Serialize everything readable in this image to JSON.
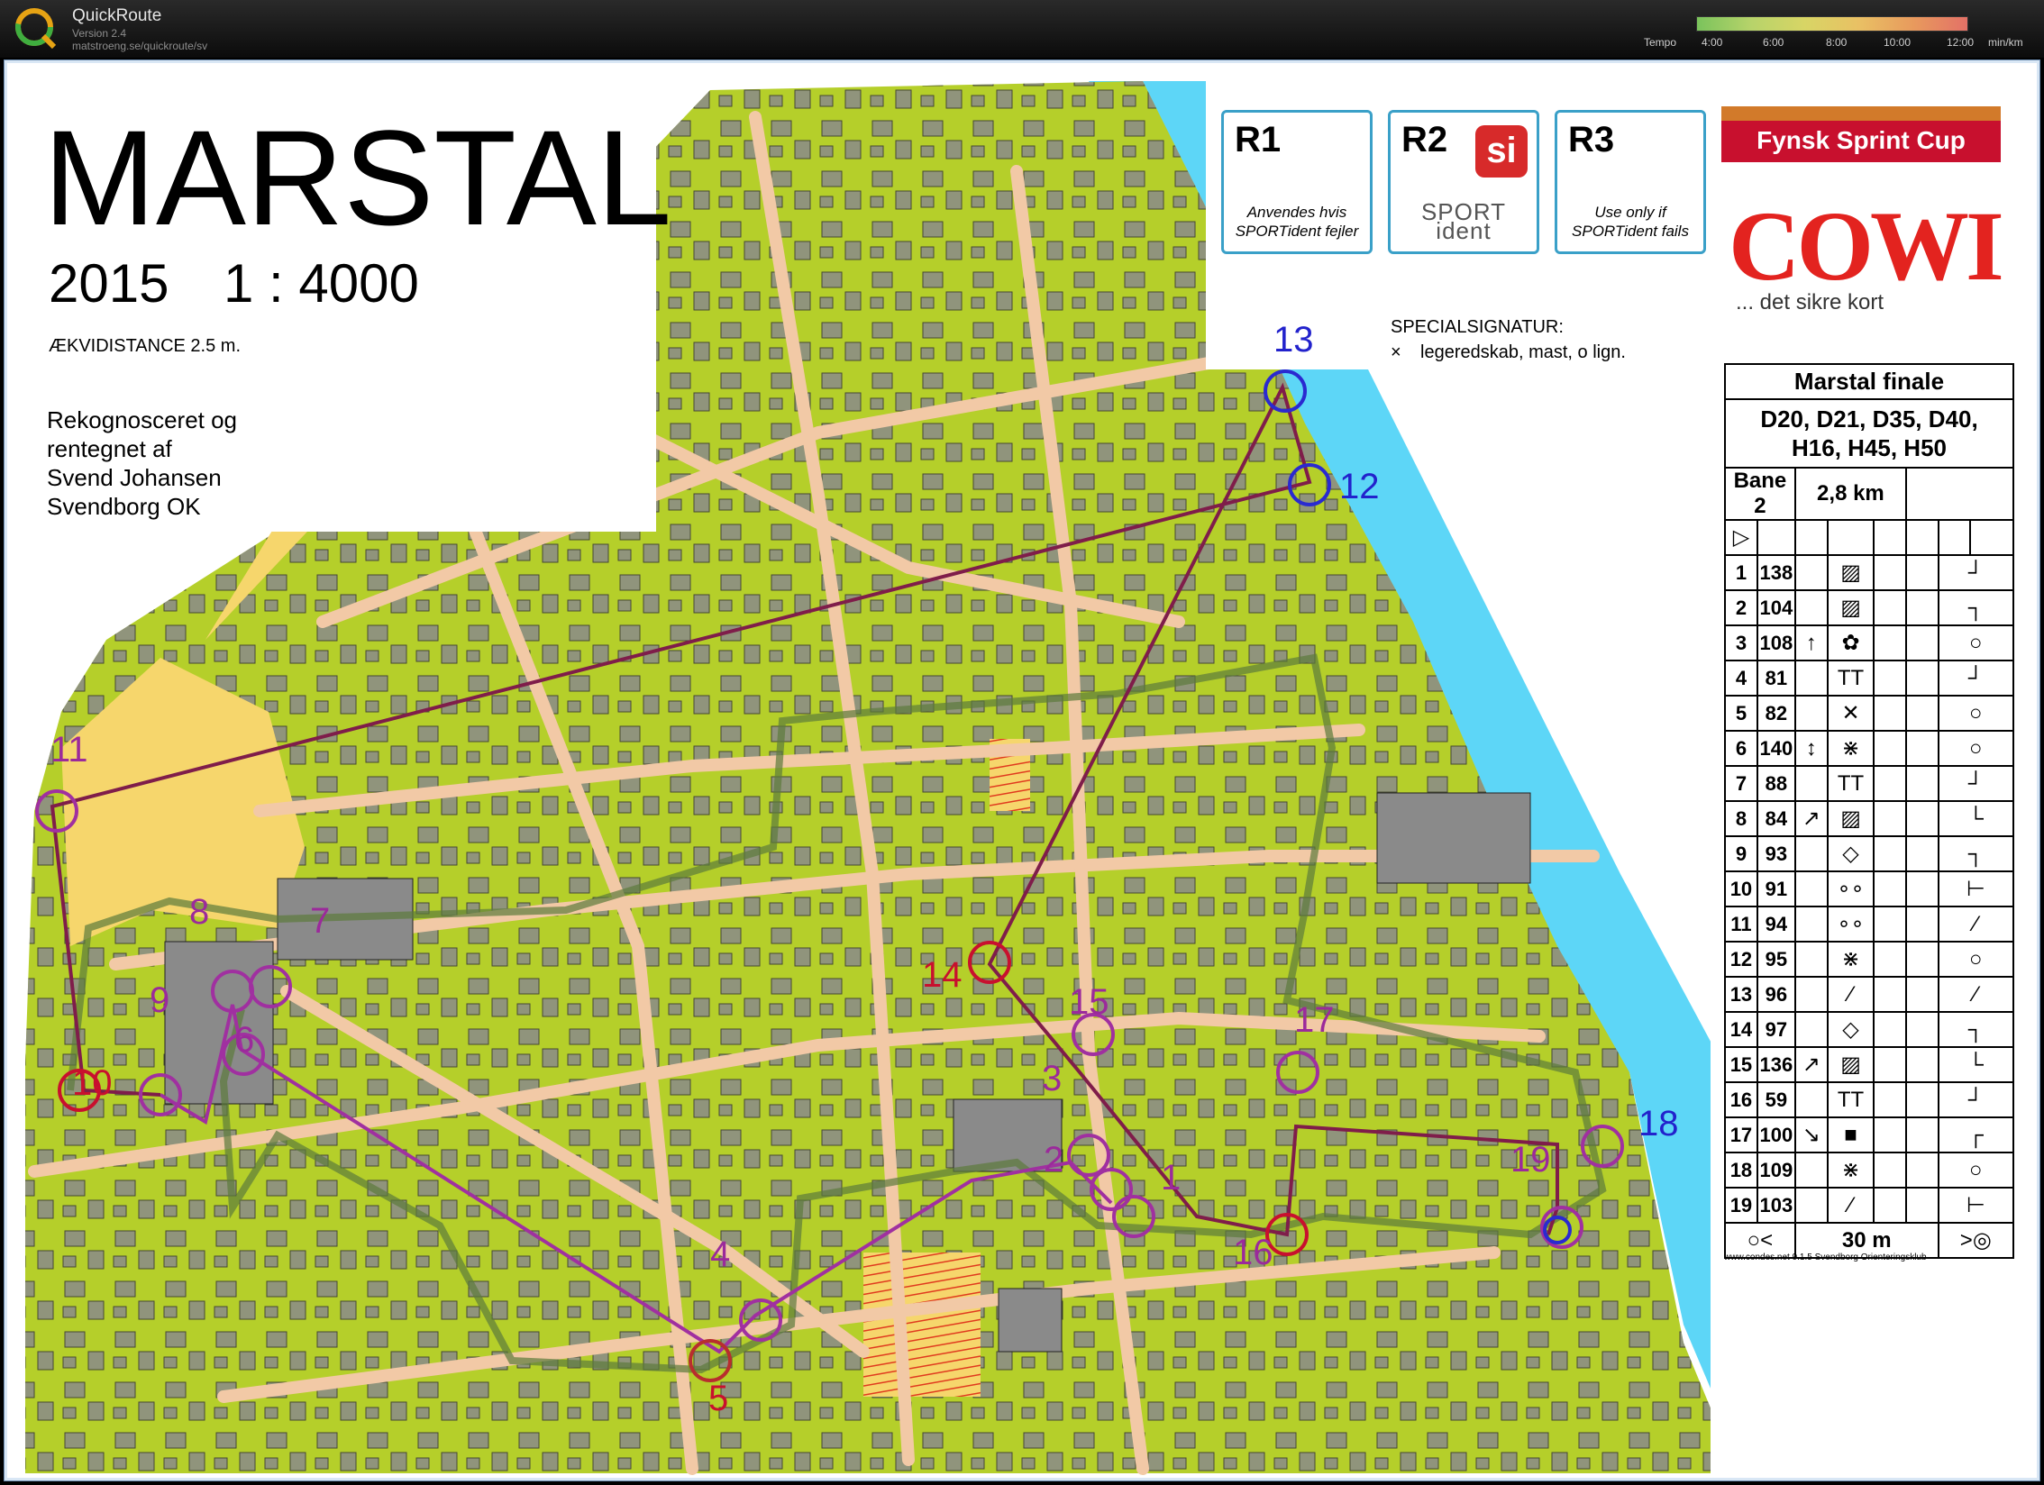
{
  "app": {
    "name": "QuickRoute",
    "version": "Version 2.4",
    "url": "matstroeng.se/quickroute/sv"
  },
  "tempo": {
    "label": "Tempo",
    "ticks": [
      "4:00",
      "6:00",
      "8:00",
      "10:00",
      "12:00"
    ],
    "unit": "min/km"
  },
  "map": {
    "title": "MARSTAL",
    "year": "2015",
    "scale": "1 : 4000",
    "contour": "ÆKVIDISTANCE 2.5 m.",
    "credits": [
      "Rekognosceret og",
      "rentegnet af",
      "Svend Johansen",
      "Svendborg OK"
    ],
    "special_title": "SPECIALSIGNATUR:",
    "special_item": "legeredskab, mast, o lign.",
    "special_symbol": "×",
    "r_boxes": [
      {
        "label": "R1",
        "note": "Anvendes hvis SPORTident fejler"
      },
      {
        "label": "R2",
        "note": "SPORT ident",
        "logo": "si"
      },
      {
        "label": "R3",
        "note": "Use only if SPORTident fails"
      }
    ],
    "sponsor_banner": "Fynsk Sprint Cup",
    "sponsor_logo": "COWI",
    "sponsor_tagline": "... det sikre kort",
    "footer_url": "www.condes.net 9.1.5 Svendborg Orienteringsklub",
    "controls": [
      "1",
      "2",
      "3",
      "4",
      "5",
      "6",
      "7",
      "8",
      "9",
      "10",
      "11",
      "12",
      "13",
      "14",
      "15",
      "16",
      "17",
      "18",
      "19"
    ]
  },
  "description": {
    "title": "Marstal finale",
    "classes": "D20, D21, D35, D40, H16, H45, H50",
    "course": "Bane 2",
    "length": "2,8 km",
    "start_symbol": "▷",
    "rows": [
      {
        "n": "1",
        "code": "138",
        "c": "",
        "d": "▨",
        "e": "",
        "f": "",
        "g": "┘"
      },
      {
        "n": "2",
        "code": "104",
        "c": "",
        "d": "▨",
        "e": "",
        "f": "",
        "g": "┐"
      },
      {
        "n": "3",
        "code": "108",
        "c": "↑",
        "d": "✿",
        "e": "",
        "f": "",
        "g": "○"
      },
      {
        "n": "4",
        "code": "81",
        "c": "",
        "d": "ΤΤ",
        "e": "",
        "f": "",
        "g": "┘"
      },
      {
        "n": "5",
        "code": "82",
        "c": "",
        "d": "✕",
        "e": "",
        "f": "",
        "g": "○"
      },
      {
        "n": "6",
        "code": "140",
        "c": "↕",
        "d": "⋇",
        "e": "",
        "f": "",
        "g": "○"
      },
      {
        "n": "7",
        "code": "88",
        "c": "",
        "d": "ΤΤ",
        "e": "",
        "f": "",
        "g": "┘"
      },
      {
        "n": "8",
        "code": "84",
        "c": "↗",
        "d": "▨",
        "e": "",
        "f": "",
        "g": "└"
      },
      {
        "n": "9",
        "code": "93",
        "c": "",
        "d": "◇",
        "e": "",
        "f": "",
        "g": "┐"
      },
      {
        "n": "10",
        "code": "91",
        "c": "",
        "d": "∘∘",
        "e": "",
        "f": "",
        "g": "⊢"
      },
      {
        "n": "11",
        "code": "94",
        "c": "",
        "d": "∘∘",
        "e": "",
        "f": "",
        "g": "∕"
      },
      {
        "n": "12",
        "code": "95",
        "c": "",
        "d": "⋇",
        "e": "",
        "f": "",
        "g": "○"
      },
      {
        "n": "13",
        "code": "96",
        "c": "",
        "d": "∕",
        "e": "",
        "f": "",
        "g": "∕"
      },
      {
        "n": "14",
        "code": "97",
        "c": "",
        "d": "◇",
        "e": "",
        "f": "",
        "g": "┐"
      },
      {
        "n": "15",
        "code": "136",
        "c": "↗",
        "d": "▨",
        "e": "",
        "f": "",
        "g": "└"
      },
      {
        "n": "16",
        "code": "59",
        "c": "",
        "d": "ΤΤ",
        "e": "",
        "f": "",
        "g": "┘"
      },
      {
        "n": "17",
        "code": "100",
        "c": "↘",
        "d": "■",
        "e": "",
        "f": "",
        "g": "┌"
      },
      {
        "n": "18",
        "code": "109",
        "c": "",
        "d": "⋇",
        "e": "",
        "f": "",
        "g": "○"
      },
      {
        "n": "19",
        "code": "103",
        "c": "",
        "d": "∕",
        "e": "",
        "f": "",
        "g": "⊢"
      }
    ],
    "finish_left": "○<",
    "finish_distance": "30 m",
    "finish_right": ">◎"
  },
  "colors": {
    "land": "#b5cf2a",
    "water": "#5dd6f7",
    "building": "#8a8a8a",
    "road": "#f2c9a6",
    "open": "#f6d66c",
    "route": "#7f1d4a",
    "course": "#a030a0",
    "control_red": "#c8102e",
    "control_blue": "#2a2ad0"
  }
}
